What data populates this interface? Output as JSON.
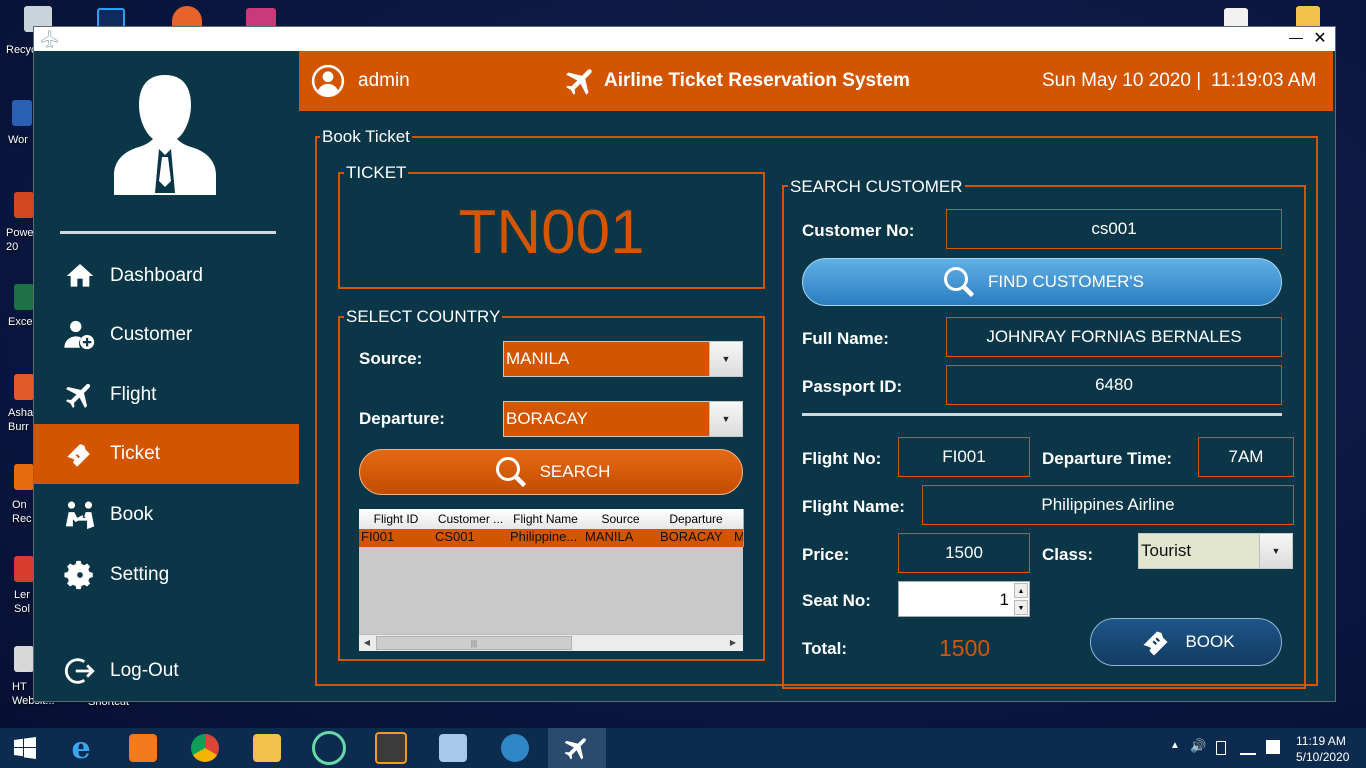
{
  "desktop": {
    "icons": [
      {
        "label": "Recyc"
      },
      {
        "label": "Wor"
      },
      {
        "label": "Powe 20"
      },
      {
        "label": "Exce"
      },
      {
        "label": "Asha Burr"
      },
      {
        "label": "On Rec"
      },
      {
        "label": "Ler Sol"
      },
      {
        "label": "HT Websit..."
      },
      {
        "label": "Shortcut"
      }
    ]
  },
  "window": {
    "minimize": "—",
    "close": "✕"
  },
  "header": {
    "user": "admin",
    "app_title": "Airline Ticket Reservation System",
    "date": "Sun May 10 2020 |",
    "time": "11:19:03 AM"
  },
  "sidebar": {
    "items": [
      {
        "label": "Dashboard",
        "icon": "home-icon"
      },
      {
        "label": "Customer",
        "icon": "add-user-icon"
      },
      {
        "label": "Flight",
        "icon": "airplane-icon"
      },
      {
        "label": "Ticket",
        "icon": "ticket-icon"
      },
      {
        "label": "Book",
        "icon": "book-icon"
      },
      {
        "label": "Setting",
        "icon": "gear-icon"
      }
    ],
    "logout": "Log-Out",
    "active_item": "Ticket"
  },
  "book": {
    "legend": "Book Ticket",
    "ticket": {
      "legend": "TICKET",
      "number": "TN001"
    },
    "country": {
      "legend": "SELECT COUNTRY",
      "source_label": "Source:",
      "source_value": "MANILA",
      "departure_label": "Departure:",
      "departure_value": "BORACAY",
      "search_button": "SEARCH",
      "columns": [
        "Flight ID",
        "Customer ...",
        "Flight Name",
        "Source",
        "Departure"
      ],
      "rows": [
        [
          "FI001",
          "CS001",
          "Philippine...",
          "MANILA",
          "BORACAY",
          "M"
        ]
      ],
      "scroll_mark": "|||"
    },
    "customer": {
      "legend": "SEARCH CUSTOMER",
      "customer_no_label": "Customer No:",
      "customer_no": "cs001",
      "find_button": "FIND CUSTOMER'S",
      "full_name_label": "Full Name:",
      "full_name": "JOHNRAY FORNIAS BERNALES",
      "passport_label": "Passport ID:",
      "passport": "6480",
      "flight_no_label": "Flight No:",
      "flight_no": "FI001",
      "departure_time_label": "Departure Time:",
      "departure_time": "7AM",
      "flight_name_label": "Flight Name:",
      "flight_name": "Philippines Airline",
      "price_label": "Price:",
      "price": "1500",
      "class_label": "Class:",
      "class_value": "Tourist",
      "seat_label": "Seat No:",
      "seat_value": "1",
      "total_label": "Total:",
      "total": "1500",
      "book_button": "BOOK"
    }
  },
  "taskbar": {
    "apps": [
      "start-icon",
      "internet-explorer-icon",
      "xampp-icon",
      "chrome-icon",
      "file-explorer-icon",
      "atom-icon",
      "sublime-icon",
      "virtualbox-icon",
      "mysql-icon",
      "airline-app-icon"
    ],
    "clock_time": "11:19 AM",
    "clock_date": "5/10/2020"
  },
  "colors": {
    "accent": "#d45500",
    "panel": "#0b3647",
    "pill_blue": "#2f86c5"
  }
}
